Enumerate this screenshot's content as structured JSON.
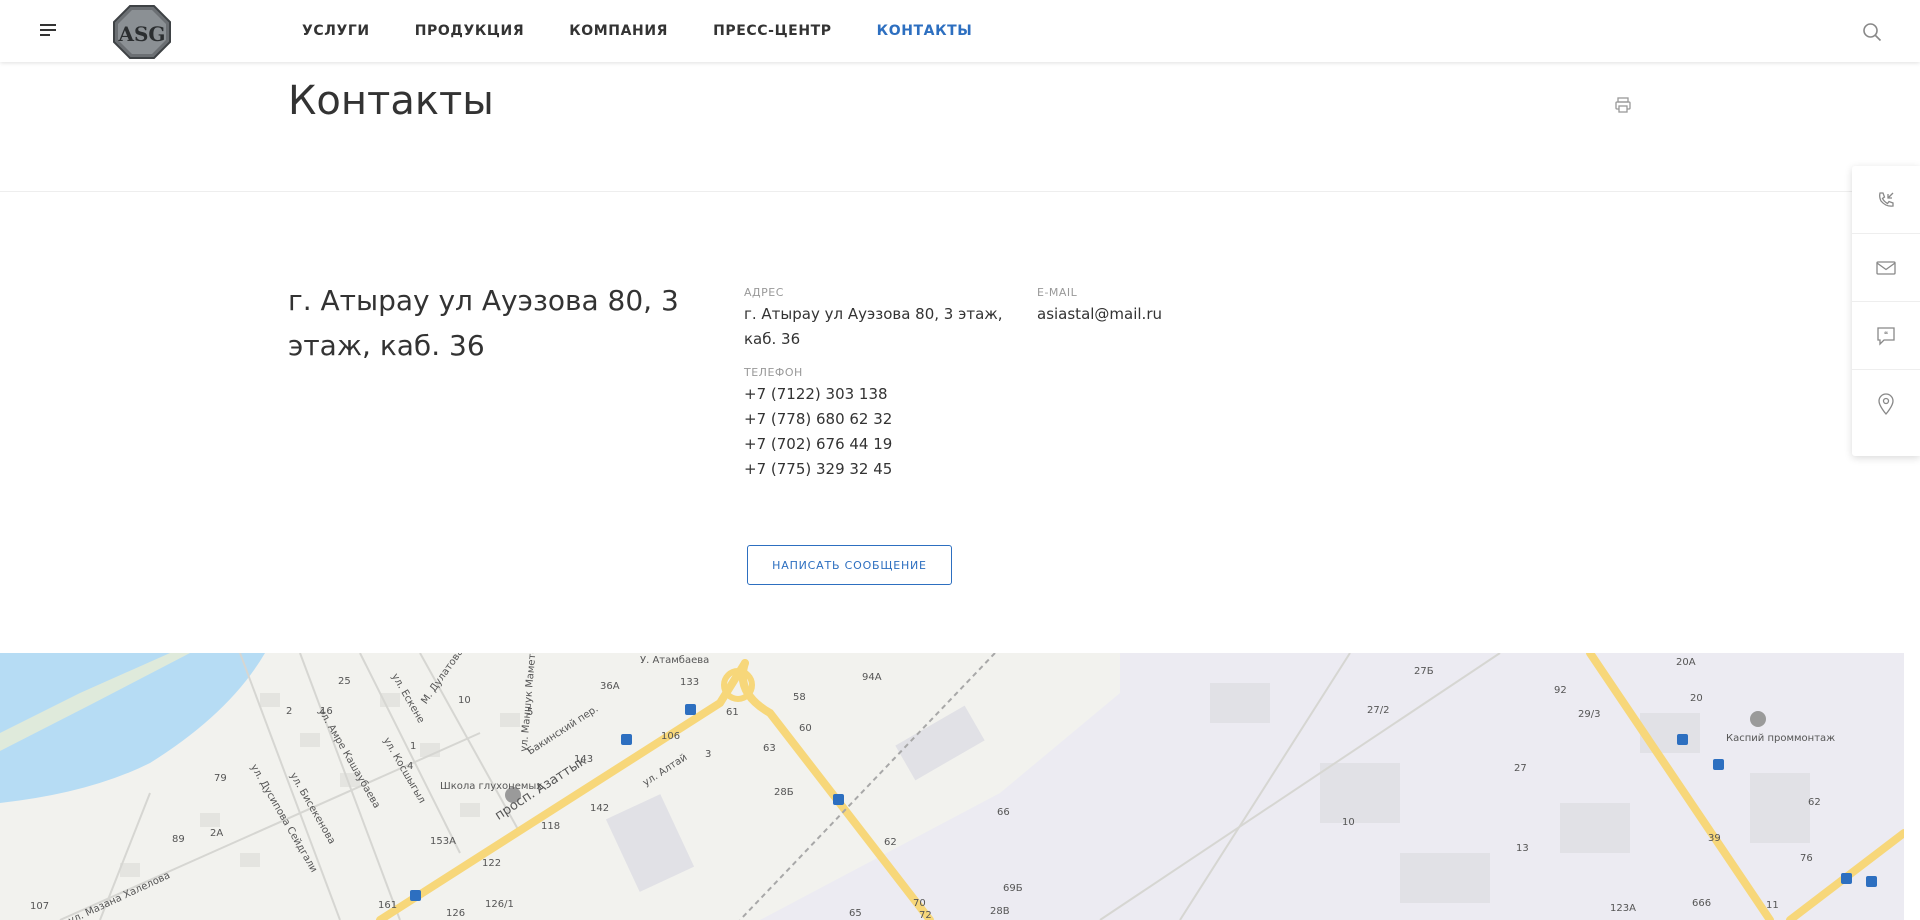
{
  "header": {
    "nav": [
      {
        "label": "УСЛУГИ",
        "active": false
      },
      {
        "label": "ПРОДУКЦИЯ",
        "active": false
      },
      {
        "label": "КОМПАНИЯ",
        "active": false
      },
      {
        "label": "ПРЕСС-ЦЕНТР",
        "active": false
      },
      {
        "label": "КОНТАКТЫ",
        "active": true
      }
    ],
    "logo_text": "ASG",
    "accent_color": "#2d6fc0"
  },
  "page": {
    "title": "Контакты"
  },
  "contacts": {
    "headline": "г. Атырау ул Ауэзова 80, 3 этаж, каб. 36",
    "address_label": "АДРЕС",
    "address": "г. Атырау ул Ауэзова 80, 3 этаж, каб. 36",
    "phone_label": "ТЕЛЕФОН",
    "phones": [
      "+7 (7122) 303 138",
      "+7 (778) 680 62 32",
      "+7 (702) 676 44 19",
      "+7 (775) 329 32 45"
    ],
    "email_label": "E-MAIL",
    "email": "asiastal@mail.ru",
    "write_button": "НАПИСАТЬ СООБЩЕНИЕ"
  },
  "side_widget": {
    "items": [
      "callback-icon",
      "mail-icon",
      "chat-icon",
      "location-icon"
    ]
  },
  "map": {
    "labels": [
      "У. Атамбаева",
      "просп. Азаттык",
      "Бакинский пер.",
      "ул. Алтай",
      "Школа глухонемых",
      "ул. Косшыгыл",
      "ул. Мазана Халелова",
      "ул. Дусипова Сейдгали",
      "ул. Бисекенова",
      "ул. Амре Кашаубаева",
      "ул. Ескене",
      "ул. Маншук Маметовой",
      "М. Дулатова",
      "Каспий проммонтаж",
      "27/2",
      "27",
      "10",
      "13",
      "29/3",
      "92",
      "20",
      "20А",
      "62",
      "39",
      "76",
      "123А",
      "666",
      "11",
      "94А",
      "58",
      "60",
      "63",
      "28Б",
      "66",
      "62",
      "69Б",
      "70",
      "72",
      "28В",
      "65",
      "133",
      "36А",
      "61",
      "106",
      "143",
      "142",
      "118",
      "153А",
      "122",
      "126",
      "126/1",
      "161",
      "107",
      "89",
      "2А",
      "79",
      "25",
      "2",
      "16",
      "10",
      "3",
      "5",
      "1",
      "4",
      "27Б"
    ]
  }
}
